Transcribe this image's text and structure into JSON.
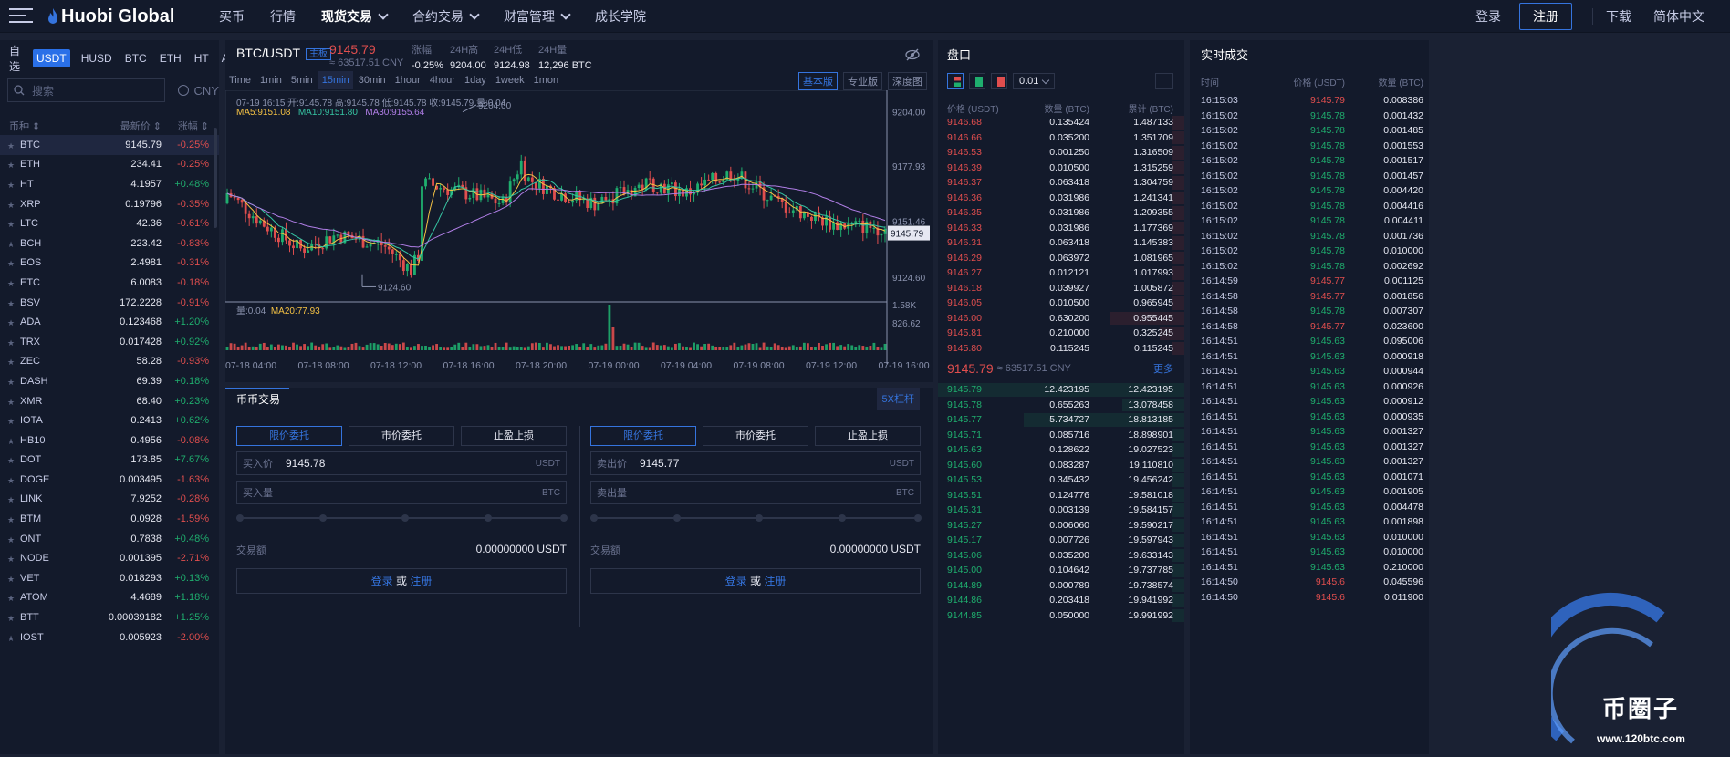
{
  "brand": {
    "name": "Huobi Global"
  },
  "nav": {
    "items": [
      "买币",
      "行情",
      "现货交易",
      "合约交易",
      "财富管理",
      "成长学院"
    ]
  },
  "topright": {
    "login": "登录",
    "register": "注册",
    "download": "下载",
    "lang": "简体中文"
  },
  "currency_tabs": [
    "自选",
    "USDT",
    "HUSD",
    "BTC",
    "ETH",
    "HT",
    "ALTS"
  ],
  "search": {
    "placeholder": "搜索",
    "cny": "CNY"
  },
  "coin_headers": {
    "name": "币种",
    "price": "最新价",
    "change": "涨幅"
  },
  "coins": [
    {
      "n": "BTC",
      "p": "9145.79",
      "c": "-0.25%"
    },
    {
      "n": "ETH",
      "p": "234.41",
      "c": "-0.25%"
    },
    {
      "n": "HT",
      "p": "4.1957",
      "c": "+0.48%"
    },
    {
      "n": "XRP",
      "p": "0.19796",
      "c": "-0.35%"
    },
    {
      "n": "LTC",
      "p": "42.36",
      "c": "-0.61%"
    },
    {
      "n": "BCH",
      "p": "223.42",
      "c": "-0.83%"
    },
    {
      "n": "EOS",
      "p": "2.4981",
      "c": "-0.31%"
    },
    {
      "n": "ETC",
      "p": "6.0083",
      "c": "-0.18%"
    },
    {
      "n": "BSV",
      "p": "172.2228",
      "c": "-0.91%"
    },
    {
      "n": "ADA",
      "p": "0.123468",
      "c": "+1.20%"
    },
    {
      "n": "TRX",
      "p": "0.017428",
      "c": "+0.92%"
    },
    {
      "n": "ZEC",
      "p": "58.28",
      "c": "-0.93%"
    },
    {
      "n": "DASH",
      "p": "69.39",
      "c": "+0.18%"
    },
    {
      "n": "XMR",
      "p": "68.40",
      "c": "+0.23%"
    },
    {
      "n": "IOTA",
      "p": "0.2413",
      "c": "+0.62%"
    },
    {
      "n": "HB10",
      "p": "0.4956",
      "c": "-0.08%"
    },
    {
      "n": "DOT",
      "p": "173.85",
      "c": "+7.67%"
    },
    {
      "n": "DOGE",
      "p": "0.003495",
      "c": "-1.63%"
    },
    {
      "n": "LINK",
      "p": "7.9252",
      "c": "-0.28%"
    },
    {
      "n": "BTM",
      "p": "0.0928",
      "c": "-1.59%"
    },
    {
      "n": "ONT",
      "p": "0.7838",
      "c": "+0.48%"
    },
    {
      "n": "NODE",
      "p": "0.001395",
      "c": "-2.71%"
    },
    {
      "n": "VET",
      "p": "0.018293",
      "c": "+0.13%"
    },
    {
      "n": "ATOM",
      "p": "4.4689",
      "c": "+1.18%"
    },
    {
      "n": "BTT",
      "p": "0.00039182",
      "c": "+1.25%"
    },
    {
      "n": "IOST",
      "p": "0.005923",
      "c": "-2.00%"
    }
  ],
  "ticker": {
    "symbol": "BTC/USDT",
    "tag": "主板",
    "price": "9145.79",
    "cny": "≈ 63517.51 CNY",
    "change_label": "涨幅",
    "change": "-0.25%",
    "high_label": "24H高",
    "high": "9204.00",
    "low_label": "24H低",
    "low": "9124.98",
    "vol_label": "24H量",
    "vol": "12,296 BTC"
  },
  "timeframes": [
    "Time",
    "1min",
    "5min",
    "15min",
    "30min",
    "1hour",
    "4hour",
    "1day",
    "1week",
    "1mon"
  ],
  "views": [
    "基本版",
    "专业版",
    "深度图"
  ],
  "chart": {
    "ohlc": "07-19 16:15   开:9145.78  高:9145.78  低:9145.78  收:9145.79  量:0.04",
    "ma5": "MA5:9151.08",
    "ma10": "MA10:9151.80",
    "ma30": "MA30:9155.64",
    "vol_label": "量:0.04",
    "ma20": "MA20:77.93",
    "y_ticks": [
      "9204.00",
      "9177.93",
      "9151.46",
      "9124.60"
    ],
    "last_price": "9145.79",
    "vol_ticks": [
      "1.58K",
      "826.62"
    ],
    "x_ticks": [
      "07-18 04:00",
      "07-18 08:00",
      "07-18 12:00",
      "07-18 16:00",
      "07-18 20:00",
      "07-19 00:00",
      "07-19 04:00",
      "07-19 08:00",
      "07-19 12:00",
      "07-19 16:00"
    ],
    "hi_mark": "9204.00",
    "lo_mark": "9124.60"
  },
  "trade": {
    "title": "币币交易",
    "leverage": "5X杠杆",
    "order_tabs": [
      "限价委托",
      "市价委托",
      "止盈止损"
    ],
    "buy": {
      "price_label": "买入价",
      "price": "9145.78",
      "unit": "USDT",
      "qty_label": "买入量",
      "qty_unit": "BTC",
      "amt_label": "交易额",
      "amt": "0.00000000 USDT"
    },
    "sell": {
      "price_label": "卖出价",
      "price": "9145.77",
      "unit": "USDT",
      "qty_label": "卖出量",
      "qty_unit": "BTC",
      "amt_label": "交易额",
      "amt": "0.00000000 USDT"
    },
    "login": "登录",
    "or": "或",
    "register": "注册"
  },
  "orderbook": {
    "title": "盘口",
    "precision": "0.01",
    "h_price": "价格 (USDT)",
    "h_qty": "数量 (BTC)",
    "h_total": "累计 (BTC)",
    "asks": [
      [
        "9146.68",
        "0.135424",
        "1.487133",
        0.05
      ],
      [
        "9146.66",
        "0.035200",
        "1.351709",
        0.05
      ],
      [
        "9146.53",
        "0.001250",
        "1.316509",
        0.05
      ],
      [
        "9146.39",
        "0.010500",
        "1.315259",
        0.05
      ],
      [
        "9146.37",
        "0.063418",
        "1.304759",
        0.05
      ],
      [
        "9146.36",
        "0.031986",
        "1.241341",
        0.05
      ],
      [
        "9146.35",
        "0.031986",
        "1.209355",
        0.05
      ],
      [
        "9146.33",
        "0.031986",
        "1.177369",
        0.05
      ],
      [
        "9146.31",
        "0.063418",
        "1.145383",
        0.05
      ],
      [
        "9146.29",
        "0.063972",
        "1.081965",
        0.05
      ],
      [
        "9146.27",
        "0.012121",
        "1.017993",
        0.05
      ],
      [
        "9146.18",
        "0.039927",
        "1.005872",
        0.05
      ],
      [
        "9146.05",
        "0.010500",
        "0.965945",
        0.05
      ],
      [
        "9146.00",
        "0.630200",
        "0.955445",
        0.3
      ],
      [
        "9145.81",
        "0.210000",
        "0.325245",
        0.1
      ],
      [
        "9145.80",
        "0.115245",
        "0.115245",
        0.05
      ]
    ],
    "mid_price": "9145.79",
    "mid_cny": "≈ 63517.51 CNY",
    "more": "更多",
    "bids": [
      [
        "9145.79",
        "12.423195",
        "12.423195",
        1.0
      ],
      [
        "9145.78",
        "0.655263",
        "13.078458",
        0.25
      ],
      [
        "9145.77",
        "5.734727",
        "18.813185",
        0.65
      ],
      [
        "9145.71",
        "0.085716",
        "18.898901",
        0.05
      ],
      [
        "9145.63",
        "0.128622",
        "19.027523",
        0.05
      ],
      [
        "9145.60",
        "0.083287",
        "19.110810",
        0.05
      ],
      [
        "9145.53",
        "0.345432",
        "19.456242",
        0.05
      ],
      [
        "9145.51",
        "0.124776",
        "19.581018",
        0.05
      ],
      [
        "9145.31",
        "0.003139",
        "19.584157",
        0.05
      ],
      [
        "9145.27",
        "0.006060",
        "19.590217",
        0.05
      ],
      [
        "9145.17",
        "0.007726",
        "19.597943",
        0.05
      ],
      [
        "9145.06",
        "0.035200",
        "19.633143",
        0.05
      ],
      [
        "9145.00",
        "0.104642",
        "19.737785",
        0.05
      ],
      [
        "9144.89",
        "0.000789",
        "19.738574",
        0.05
      ],
      [
        "9144.86",
        "0.203418",
        "19.941992",
        0.05
      ],
      [
        "9144.85",
        "0.050000",
        "19.991992",
        0.05
      ]
    ]
  },
  "recent": {
    "title": "实时成交",
    "h_time": "时间",
    "h_price": "价格 (USDT)",
    "h_qty": "数量 (BTC)",
    "rows": [
      [
        "16:15:03",
        "9145.79",
        "0.008386",
        "d"
      ],
      [
        "16:15:02",
        "9145.78",
        "0.001432",
        "u"
      ],
      [
        "16:15:02",
        "9145.78",
        "0.001485",
        "u"
      ],
      [
        "16:15:02",
        "9145.78",
        "0.001553",
        "u"
      ],
      [
        "16:15:02",
        "9145.78",
        "0.001517",
        "u"
      ],
      [
        "16:15:02",
        "9145.78",
        "0.001457",
        "u"
      ],
      [
        "16:15:02",
        "9145.78",
        "0.004420",
        "u"
      ],
      [
        "16:15:02",
        "9145.78",
        "0.004416",
        "u"
      ],
      [
        "16:15:02",
        "9145.78",
        "0.004411",
        "u"
      ],
      [
        "16:15:02",
        "9145.78",
        "0.001736",
        "u"
      ],
      [
        "16:15:02",
        "9145.78",
        "0.010000",
        "u"
      ],
      [
        "16:15:02",
        "9145.78",
        "0.002692",
        "u"
      ],
      [
        "16:14:59",
        "9145.77",
        "0.001125",
        "d"
      ],
      [
        "16:14:58",
        "9145.77",
        "0.001856",
        "d"
      ],
      [
        "16:14:58",
        "9145.78",
        "0.007307",
        "u"
      ],
      [
        "16:14:58",
        "9145.77",
        "0.023600",
        "d"
      ],
      [
        "16:14:51",
        "9145.63",
        "0.095006",
        "u"
      ],
      [
        "16:14:51",
        "9145.63",
        "0.000918",
        "u"
      ],
      [
        "16:14:51",
        "9145.63",
        "0.000944",
        "u"
      ],
      [
        "16:14:51",
        "9145.63",
        "0.000926",
        "u"
      ],
      [
        "16:14:51",
        "9145.63",
        "0.000912",
        "u"
      ],
      [
        "16:14:51",
        "9145.63",
        "0.000935",
        "u"
      ],
      [
        "16:14:51",
        "9145.63",
        "0.001327",
        "u"
      ],
      [
        "16:14:51",
        "9145.63",
        "0.001327",
        "u"
      ],
      [
        "16:14:51",
        "9145.63",
        "0.001327",
        "u"
      ],
      [
        "16:14:51",
        "9145.63",
        "0.001071",
        "u"
      ],
      [
        "16:14:51",
        "9145.63",
        "0.001905",
        "u"
      ],
      [
        "16:14:51",
        "9145.63",
        "0.004478",
        "u"
      ],
      [
        "16:14:51",
        "9145.63",
        "0.001898",
        "u"
      ],
      [
        "16:14:51",
        "9145.63",
        "0.010000",
        "u"
      ],
      [
        "16:14:51",
        "9145.63",
        "0.010000",
        "u"
      ],
      [
        "16:14:51",
        "9145.63",
        "0.210000",
        "u"
      ],
      [
        "16:14:50",
        "9145.6",
        "0.045596",
        "d"
      ],
      [
        "16:14:50",
        "9145.6",
        "0.011900",
        "d"
      ]
    ]
  },
  "watermark": {
    "cn": "币圈子",
    "url": "www.120btc.com"
  },
  "colors": {
    "up": "#1fae6e",
    "down": "#e04e4e",
    "accent": "#3574de",
    "ma5": "#f5c244",
    "ma10": "#36c6a4",
    "ma30": "#b07ee6"
  }
}
